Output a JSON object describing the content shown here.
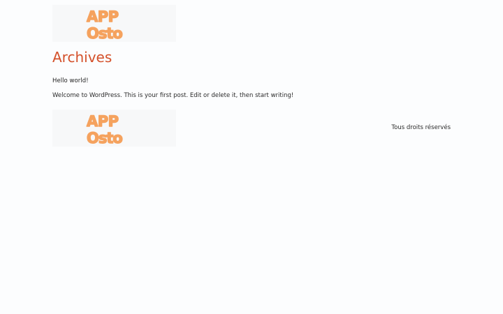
{
  "header": {
    "logo_text_line1": "APP",
    "logo_text_line2": "Osto"
  },
  "main": {
    "archive_title": "Archives",
    "posts": [
      {
        "title": "Hello world!",
        "excerpt": "Welcome to WordPress. This is your first post. Edit or delete it, then start writing!"
      }
    ]
  },
  "footer": {
    "logo_text_line1": "APP",
    "logo_text_line2": "Osto",
    "copyright": "Tous droits réservés"
  },
  "colors": {
    "accent": "#d4512b",
    "logo_orange": "#f5a25e",
    "background": "#fcfdfe"
  }
}
